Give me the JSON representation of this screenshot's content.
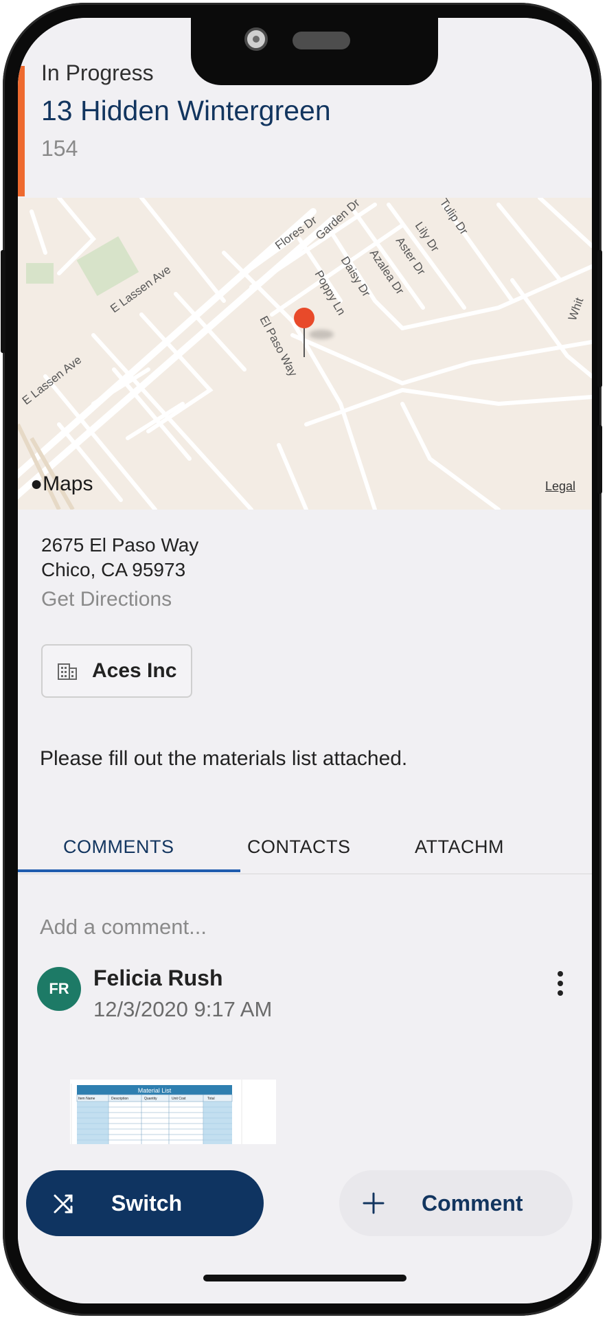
{
  "job": {
    "status": "In Progress",
    "title": "13 Hidden Wintergreen",
    "number": "154",
    "accent_color": "#ee6a2f"
  },
  "map": {
    "brand": "Maps",
    "legal": "Legal",
    "streets": [
      "E Lassen Ave",
      "E Lassen Ave",
      "Flores Dr",
      "Garden Dr",
      "Daisy Dr",
      "Poppy Ln",
      "El Paso Way",
      "Azalea Dr",
      "Aster Dr",
      "Lily Dr",
      "Tulip Dr",
      "Whit"
    ]
  },
  "address": {
    "line1": "2675 El Paso Way",
    "line2": "Chico, CA 95973",
    "directions_label": "Get Directions"
  },
  "customer": {
    "name": "Aces Inc",
    "icon": "building-icon"
  },
  "description": "Please fill out the materials list attached.",
  "tabs": [
    {
      "label": "COMMENTS",
      "active": true
    },
    {
      "label": "CONTACTS",
      "active": false
    },
    {
      "label": "ATTACHM",
      "active": false
    }
  ],
  "comments": {
    "placeholder": "Add a comment...",
    "items": [
      {
        "initials": "FR",
        "author": "Felicia Rush",
        "timestamp": "12/3/2020 9:17 AM",
        "attachment": {
          "title": "Material List",
          "columns": [
            "Item Name",
            "Description",
            "Quantity",
            "Unit Cost",
            "Total"
          ]
        }
      }
    ]
  },
  "actions": {
    "switch_label": "Switch",
    "comment_label": "Comment"
  },
  "colors": {
    "primary": "#0f3461",
    "tab_indicator": "#1f5cae",
    "avatar": "#1d7a66"
  }
}
